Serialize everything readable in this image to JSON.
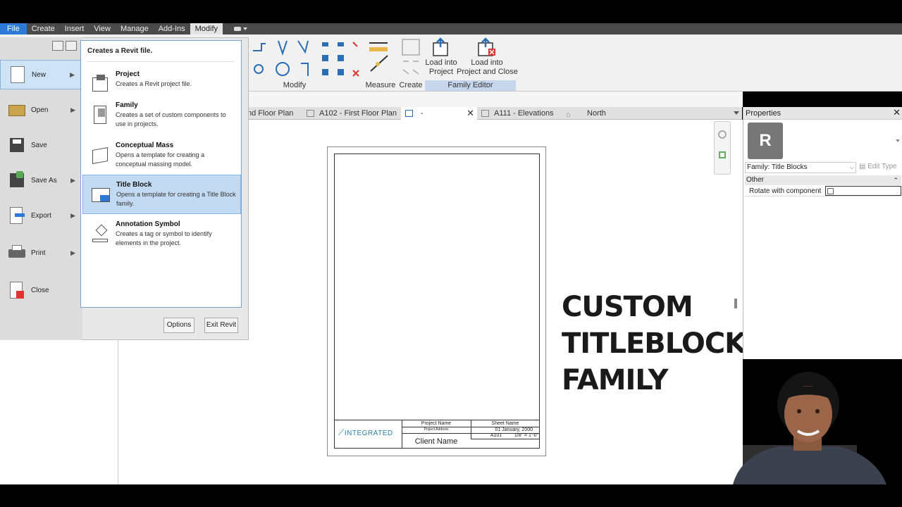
{
  "menubar": {
    "tabs": [
      "File",
      "Create",
      "Insert",
      "View",
      "Manage",
      "Add-Ins",
      "Modify"
    ],
    "active": "Modify"
  },
  "ribbon": {
    "panels": {
      "modify": "Modify",
      "measure": "Measure",
      "create": "Create",
      "family_editor": "Family Editor"
    },
    "load_into_project": "Load into\nProject",
    "load_into_project_close": "Load into\nProject and Close"
  },
  "view_tabs": [
    "nd Floor Plan",
    "A102 - First Floor Plan",
    "-",
    "A111 - Elevations",
    "North"
  ],
  "file_menu": {
    "header": "Creates a Revit file.",
    "left_items": [
      "New",
      "Open",
      "Save",
      "Save As",
      "Export",
      "Print",
      "Close"
    ],
    "new_items": [
      {
        "title": "Project",
        "desc": "Creates a Revit project file."
      },
      {
        "title": "Family",
        "desc": "Creates a set of custom components to use in projects."
      },
      {
        "title": "Conceptual Mass",
        "desc": "Opens a template for creating a conceptual massing model."
      },
      {
        "title": "Title Block",
        "desc": "Opens a template for creating a Title Block family."
      },
      {
        "title": "Annotation Symbol",
        "desc": "Creates a tag or symbol to identify elements in the project."
      }
    ],
    "options_button": "Options",
    "exit_button": "Exit Revit"
  },
  "properties": {
    "title": "Properties",
    "type_selector": "Family: Title Blocks",
    "edit_type": "Edit Type",
    "group": "Other",
    "row_label": "Rotate with component"
  },
  "titleblock": {
    "logo": "INTEGRATED",
    "project_name": "Project Name",
    "project_address": "Project Address",
    "client_name": "Client Name",
    "sheet_name": "Sheet Name",
    "date": "01 January, 2000",
    "sheet_number": "A101",
    "scale": "1/8\" = 1'-0\""
  },
  "overlay_title": [
    "CUSTOM",
    "TITLEBLOCK",
    "FAMILY"
  ],
  "colors": {
    "file_tab": "#2d7ad6",
    "accent_sel": "#c3dbf2",
    "menubar": "#4a4a4a",
    "family_band": "#c6d6ec"
  }
}
